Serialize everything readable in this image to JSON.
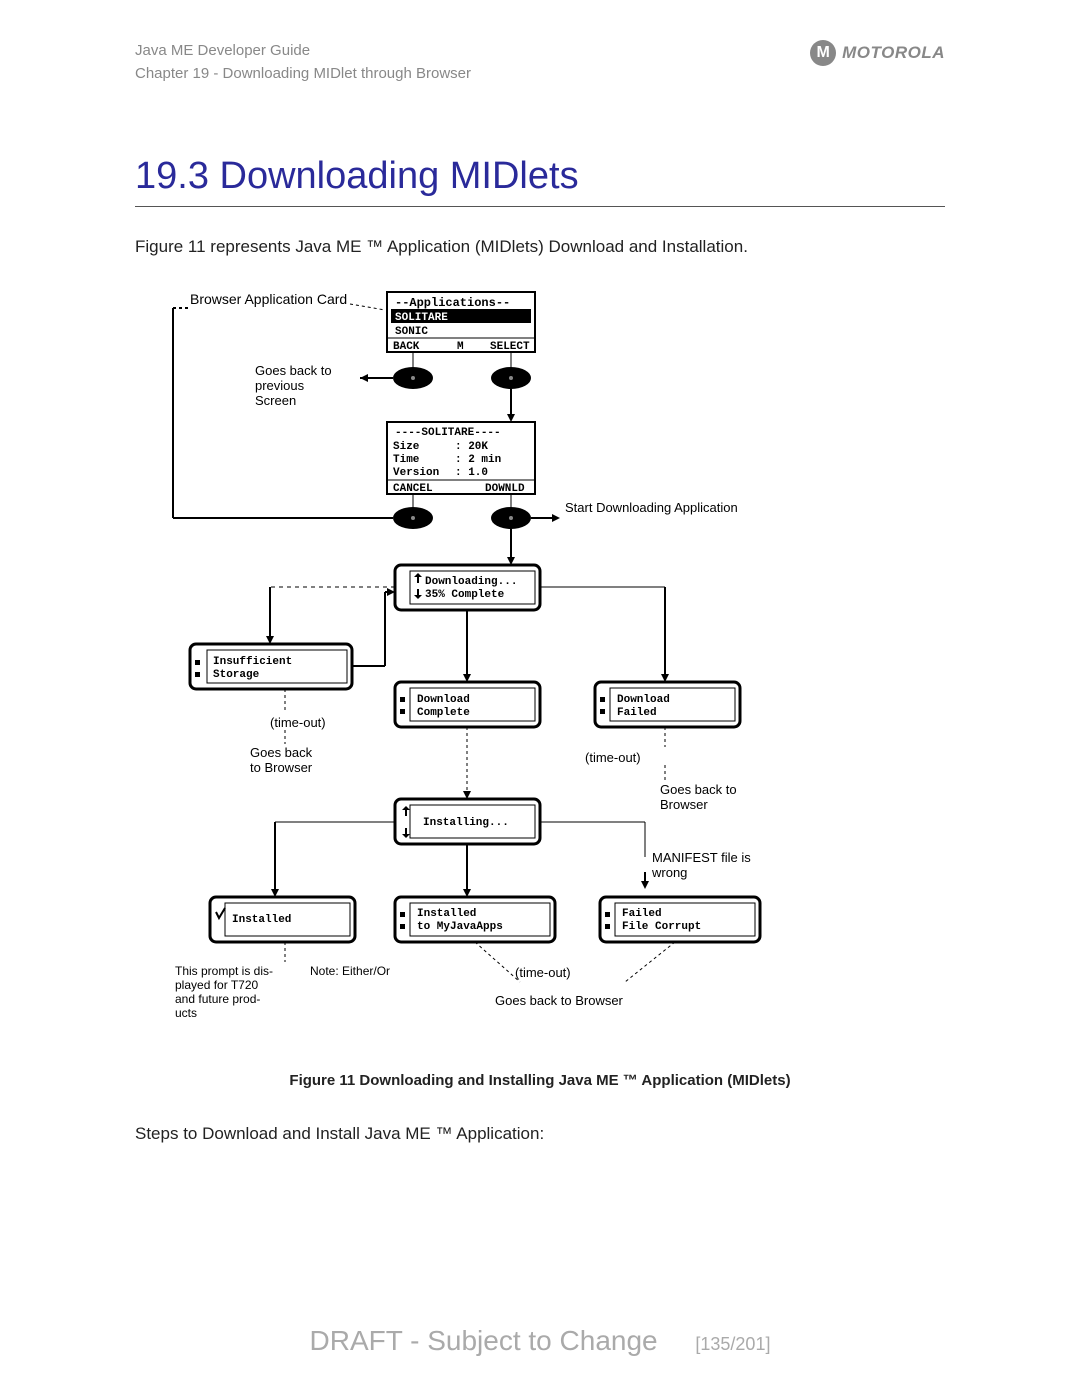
{
  "header": {
    "line1": "Java ME Developer Guide",
    "line2": "Chapter 19 - Downloading MIDlet through Browser",
    "brand": "MOTOROLA",
    "brand_letter": "M"
  },
  "title": "19.3 Downloading MIDlets",
  "intro": "Figure 11 represents Java ME ™ Application (MIDlets) Download and Installation.",
  "caption": "Figure 11 Downloading and Installing Java ME ™ Application (MIDlets)",
  "steps_intro": "Steps to Download and Install Java ME ™ Application:",
  "footer": {
    "draft": "DRAFT - Subject to Change",
    "page": "[135/201]"
  },
  "diagram": {
    "browser_card": "Browser Application Card",
    "apps_title": "--Applications--",
    "apps_item1": "SOLITARE",
    "apps_item2": "SONIC",
    "apps_back": "BACK",
    "apps_m": "M",
    "apps_select": "SELECT",
    "goes_back_prev1": "Goes back to",
    "goes_back_prev2": "previous",
    "goes_back_prev3": "Screen",
    "details_title": "----SOLITARE----",
    "details_size_l": "Size",
    "details_size_v": ": 20K",
    "details_time_l": "Time",
    "details_time_v": ": 2 min",
    "details_ver_l": "Version",
    "details_ver_v": ": 1.0",
    "details_cancel": "CANCEL",
    "details_download": "DOWNLD",
    "start_dl": "Start Downloading Application",
    "downloading1": "Downloading...",
    "downloading2": "35% Complete",
    "insufficient1": "Insufficient",
    "insufficient2": "Storage",
    "dl_complete1": "Download",
    "dl_complete2": "Complete",
    "dl_failed1": "Download",
    "dl_failed2": "Failed",
    "timeout": "(time-out)",
    "goes_back_browser1": "Goes back",
    "goes_back_browser2": "to Browser",
    "goes_back_browser_single": "Goes back to",
    "browser_word": "Browser",
    "installing": "Installing...",
    "manifest1": "MANIFEST file is",
    "manifest2": "wrong",
    "installed": "Installed",
    "installed_my1": "Installed",
    "installed_my2": "to MyJavaApps",
    "failed_corrupt1": "Failed",
    "failed_corrupt2": "File Corrupt",
    "prompt1": "This prompt is dis-",
    "prompt2": "played for T720",
    "prompt3": "and future prod-",
    "prompt4": "ucts",
    "note": "Note: Either/Or",
    "goes_back_bottom": "Goes back to Browser"
  }
}
